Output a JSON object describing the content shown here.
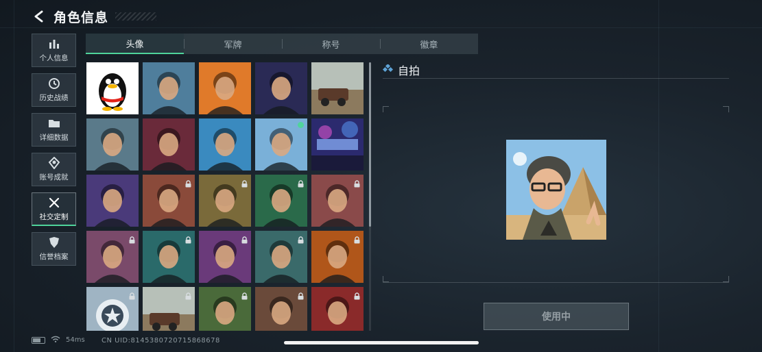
{
  "header": {
    "title": "角色信息"
  },
  "sidebar": {
    "items": [
      {
        "label": "个人信息",
        "icon": "bar-chart-icon",
        "active": false
      },
      {
        "label": "历史战绩",
        "icon": "history-clock-icon",
        "active": false
      },
      {
        "label": "详细数据",
        "icon": "folder-icon",
        "active": false
      },
      {
        "label": "账号成就",
        "icon": "achievement-icon",
        "active": false
      },
      {
        "label": "社交定制",
        "icon": "tools-icon",
        "active": true
      },
      {
        "label": "信誉档案",
        "icon": "reputation-shield-icon",
        "active": false
      }
    ]
  },
  "tabs": [
    {
      "label": "头像",
      "active": true
    },
    {
      "label": "军牌",
      "active": false
    },
    {
      "label": "称号",
      "active": false
    },
    {
      "label": "徽章",
      "active": false
    }
  ],
  "avatars": [
    {
      "name": "qq-penguin",
      "locked": false,
      "selected": false,
      "bg": "#ffffff"
    },
    {
      "name": "pilot",
      "locked": false,
      "selected": false,
      "bg": "#4f7e9c"
    },
    {
      "name": "operator-orange",
      "locked": false,
      "selected": false,
      "bg": "#e07a2a"
    },
    {
      "name": "book-explorer",
      "locked": false,
      "selected": false,
      "bg": "#2a2a55"
    },
    {
      "name": "desert-truck",
      "locked": false,
      "selected": false,
      "bg": "#8a7a66"
    },
    {
      "name": "climber",
      "locked": false,
      "selected": false,
      "bg": "#5a7a8a"
    },
    {
      "name": "goggles-operator",
      "locked": false,
      "selected": false,
      "bg": "#6a2a3a"
    },
    {
      "name": "monkey-reader",
      "locked": false,
      "selected": false,
      "bg": "#3a8abf"
    },
    {
      "name": "selfie",
      "locked": false,
      "selected": true,
      "bg": "#7ab0d8"
    },
    {
      "name": "new-year-2026",
      "locked": false,
      "selected": false,
      "bg": "#3a2a7a"
    },
    {
      "name": "purple-operator",
      "locked": false,
      "selected": false,
      "bg": "#4a3a7a"
    },
    {
      "name": "bearded-headset",
      "locked": true,
      "selected": false,
      "bg": "#8a4a3a"
    },
    {
      "name": "bald-headset",
      "locked": true,
      "selected": false,
      "bg": "#7a6a3a"
    },
    {
      "name": "green-headset",
      "locked": true,
      "selected": false,
      "bg": "#2a6a4a"
    },
    {
      "name": "helmet-operator",
      "locked": true,
      "selected": false,
      "bg": "#8a4a4a"
    },
    {
      "name": "white-hair",
      "locked": true,
      "selected": false,
      "bg": "#7a4a6a"
    },
    {
      "name": "teal-operator",
      "locked": true,
      "selected": false,
      "bg": "#2a6a6a"
    },
    {
      "name": "purple-hair",
      "locked": true,
      "selected": false,
      "bg": "#6a3a7a"
    },
    {
      "name": "masked-teal",
      "locked": true,
      "selected": false,
      "bg": "#3a6a6a"
    },
    {
      "name": "masked-orange",
      "locked": true,
      "selected": false,
      "bg": "#b0561a"
    },
    {
      "name": "emblem-badge",
      "locked": true,
      "selected": false,
      "bg": "#8aa0b0"
    },
    {
      "name": "helicopter-field",
      "locked": true,
      "selected": false,
      "bg": "#8a9a8a"
    },
    {
      "name": "gold-robot",
      "locked": true,
      "selected": false,
      "bg": "#4a6a3a"
    },
    {
      "name": "bronze-scales",
      "locked": true,
      "selected": false,
      "bg": "#6a4a3a"
    },
    {
      "name": "red-hair-woman",
      "locked": true,
      "selected": false,
      "bg": "#8a2a2a"
    }
  ],
  "detail": {
    "icon": "diamond-icon",
    "title": "自拍",
    "button_label": "使用中"
  },
  "status": {
    "ping": "54ms",
    "uid": "CN UID:8145380720715868678"
  },
  "colors": {
    "accent": "#4fd49b",
    "lock": "#d8dde0"
  }
}
